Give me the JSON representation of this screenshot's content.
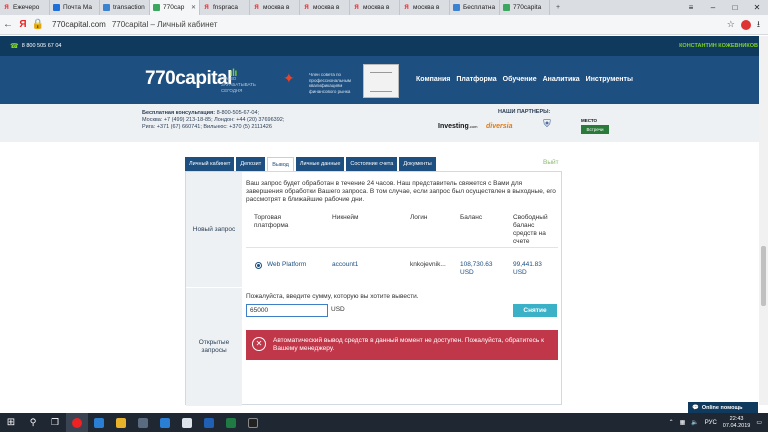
{
  "browser": {
    "tabs": [
      {
        "label": "Ежечеро",
        "icon": "yandex-icon",
        "active": false
      },
      {
        "label": "Почта Ма",
        "icon": "mail-icon",
        "active": false
      },
      {
        "label": "transaction",
        "icon": "doc-icon",
        "active": false
      },
      {
        "label": "770cap",
        "icon": "770capital-icon",
        "active": true
      },
      {
        "label": "fnspraca",
        "icon": "yandex-icon",
        "active": false
      },
      {
        "label": "москва в",
        "icon": "yandex-icon",
        "active": false
      },
      {
        "label": "москва в",
        "icon": "yandex-icon",
        "active": false
      },
      {
        "label": "москва в",
        "icon": "yandex-icon",
        "active": false
      },
      {
        "label": "москва в",
        "icon": "yandex-icon",
        "active": false
      },
      {
        "label": "Бесплатна",
        "icon": "doc-icon",
        "active": false
      },
      {
        "label": "770capita",
        "icon": "770capital-icon",
        "active": false
      }
    ],
    "url_domain": "770capital.com",
    "url_title": "770capital – Личный кабинет",
    "yandex_letter": "Я"
  },
  "site": {
    "phone": "8 800 505 67 04",
    "user": "КОНСТАНТИН КОЖЕВНИКОВ",
    "logo": "770capital",
    "logo_sub": "ПРАВО ЗАРАБАТЫВАТЬ СЕГОДНЯ",
    "member_text": "Член совета по профессиональным квалификациям финансового рынка",
    "nav": [
      "Компания",
      "Платформа",
      "Обучение",
      "Аналитика",
      "Инструменты"
    ],
    "consult": {
      "line1_label": "Бесплатная консультация:",
      "line1_value": "8-800-505-67-04;",
      "line2": "Москва: +7 (499) 213-18-85; Лондон: +44 (20) 37696392;",
      "line3": "Рига: +371 (67) 660741; Вильнюс: +370 (5) 2111426"
    },
    "partners_label": "НАШИ ПАРТНЕРЫ:",
    "partner_investing": "Investing",
    "partner_investing_suffix": ".com",
    "partner_diversia": "diversia",
    "partner_mesto_label": "МЕСТО",
    "partner_mesto": "Встречи"
  },
  "account": {
    "tabs": [
      "Личный кабинет",
      "Депозит",
      "Вывод",
      "Личные данные",
      "Состояние счета",
      "Документы"
    ],
    "active_tab": "Вывод",
    "exit_link": "Выйт",
    "side_new": "Новый запрос",
    "side_open": "Открытые запросы",
    "notice": "Ваш запрос будет обработан в течение 24 часов. Наш представитель свяжется с Вами для завершения обработки Вашего запроса. В том случае, если запрос был осуществлен в выходные, его рассмотрят в ближайшие рабочие дни.",
    "columns": {
      "platform": "Торговая платформа",
      "nickname": "Никнейм",
      "login": "Логин",
      "balance": "Баланс",
      "free_balance": "Свободный баланс средств на счете"
    },
    "row": {
      "platform": "Web Platform",
      "nickname": "account1",
      "login": "knkojevnik...",
      "balance": "108,730.63",
      "balance_cur": "USD",
      "free_balance": "99,441.83",
      "free_cur": "USD"
    },
    "prompt": "Пожалуйста, введите сумму, которую вы хотите вывести.",
    "amount_value": "65000",
    "currency": "USD",
    "withdraw_button": "Снятие",
    "alert": "Автоматический вывод средств в данный момент не доступен. Пожалуйста, обратитесь к Вашему менеджеру.",
    "chat": "Online помощь"
  },
  "taskbar": {
    "lang": "РУС",
    "time": "22:43",
    "date": "07.04.2019"
  },
  "colors": {
    "header_bg": "#1d4f80",
    "accent_green": "#7ed321",
    "alert_red": "#c1374a",
    "button_cyan": "#3bb1c8"
  }
}
